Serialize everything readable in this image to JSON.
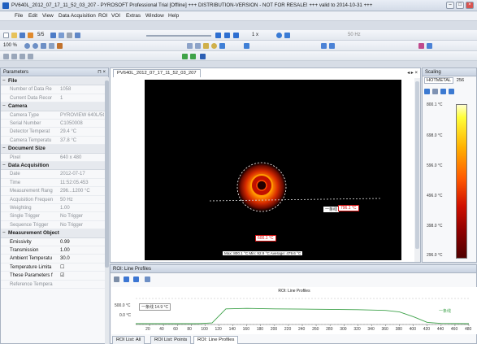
{
  "window": {
    "title": "PV640L_2012_07_17_11_52_03_207 - PYROSOFT Professional Trial [Offline] +++ DISTRIBUTION-VERSION - NOT FOR RESALE! +++ valid to 2014-10-31 +++"
  },
  "menu": [
    "File",
    "Edit",
    "View",
    "Data Acquisition",
    "ROI",
    "VOI",
    "Extras",
    "Window",
    "Help"
  ],
  "toolbar": {
    "frame_counter": "5/5",
    "zoom": "100 %",
    "speed": "1 x",
    "rate": "50 Hz"
  },
  "parameters": {
    "title": "Parameters",
    "pin": "⊓ ×",
    "categories": {
      "file": "File",
      "camera": "Camera",
      "document_size": "Document Size",
      "data_acquisition": "Data Acquisition",
      "measurement_object": "Measurement Object"
    },
    "rows": {
      "file": [
        {
          "key": "Number of Data Re",
          "value": "1058"
        },
        {
          "key": "Current Data Recor",
          "value": "1"
        }
      ],
      "camera": [
        {
          "key": "Camera Type",
          "value": "PYROVIEW 640L/5C"
        },
        {
          "key": "Serial Number",
          "value": "C1050008"
        },
        {
          "key": "Detector Temperat",
          "value": "29.4 °C"
        },
        {
          "key": "Camera Temperatu",
          "value": "37.8 °C"
        }
      ],
      "document_size": [
        {
          "key": "Pixel",
          "value": "640 x 480"
        }
      ],
      "data_acquisition": [
        {
          "key": "Date",
          "value": "2012-07-17"
        },
        {
          "key": "Time",
          "value": "11:52:05.453"
        },
        {
          "key": "Measurement Rang",
          "value": "296...1200 °C"
        },
        {
          "key": "Acquisition Frequen",
          "value": "50 Hz"
        },
        {
          "key": "Weighting",
          "value": "1.00"
        },
        {
          "key": "Single Trigger",
          "value": "No Trigger"
        },
        {
          "key": "Sequence Trigger",
          "value": "No Trigger"
        }
      ],
      "measurement_object": [
        {
          "key": "Emissivity",
          "value": "0.99"
        },
        {
          "key": "Transmission",
          "value": "1.00"
        },
        {
          "key": "Ambient Temperatu",
          "value": "30.0"
        },
        {
          "key": "Temperature Limita",
          "value": "☐"
        },
        {
          "key": "These Parameters f",
          "value": "☑"
        },
        {
          "key": "Reference Tempera",
          "value": ""
        }
      ]
    }
  },
  "document": {
    "tab": "PV640L_2012_07_17_11_52_03_207",
    "corner_controls": "◂ ▸ ×",
    "hot_label": "796.1 °C",
    "line_label": "一条线",
    "low_label": "600.1 °C",
    "status": "Max: 800.1 °C  Min: 92.9 °C  Average: 479.6 °C"
  },
  "scaling": {
    "title": "Scaling",
    "palette": "HOTMETAL",
    "steps": "256",
    "ticks": [
      {
        "label": "800.1 °C"
      },
      {
        "label": "698.0 °C"
      },
      {
        "label": "596.0 °C"
      },
      {
        "label": "496.0 °C"
      },
      {
        "label": "398.0 °C"
      },
      {
        "label": "296.0 °C"
      }
    ]
  },
  "roi_panel": {
    "title": "ROI: Line Profiles",
    "tabs": [
      "ROI List: All",
      "ROI List: Points",
      "ROI: Line Profiles"
    ]
  },
  "chart_data": {
    "type": "line",
    "title": "ROI: Line Profiles",
    "xlabel": "",
    "ylabel": "",
    "ylim": [
      0,
      500
    ],
    "xlim": [
      0,
      480
    ],
    "ytick_labels": [
      "500.0 °C",
      "0.0 °C"
    ],
    "xticks": [
      20,
      40,
      60,
      80,
      100,
      120,
      140,
      160,
      180,
      200,
      220,
      240,
      260,
      280,
      300,
      320,
      340,
      360,
      380,
      400,
      420,
      440,
      460,
      480
    ],
    "series": [
      {
        "name": "一条线",
        "legend_left": "一条线  14.9 °C",
        "legend_right": "一条线",
        "color": "#3ea24a",
        "x": [
          0,
          60,
          90,
          110,
          130,
          160,
          200,
          240,
          280,
          320,
          360,
          380,
          400,
          420,
          440,
          480
        ],
        "y": [
          14.9,
          15,
          15,
          30,
          300,
          310,
          300,
          295,
          290,
          285,
          270,
          240,
          150,
          40,
          20,
          15
        ]
      }
    ]
  }
}
